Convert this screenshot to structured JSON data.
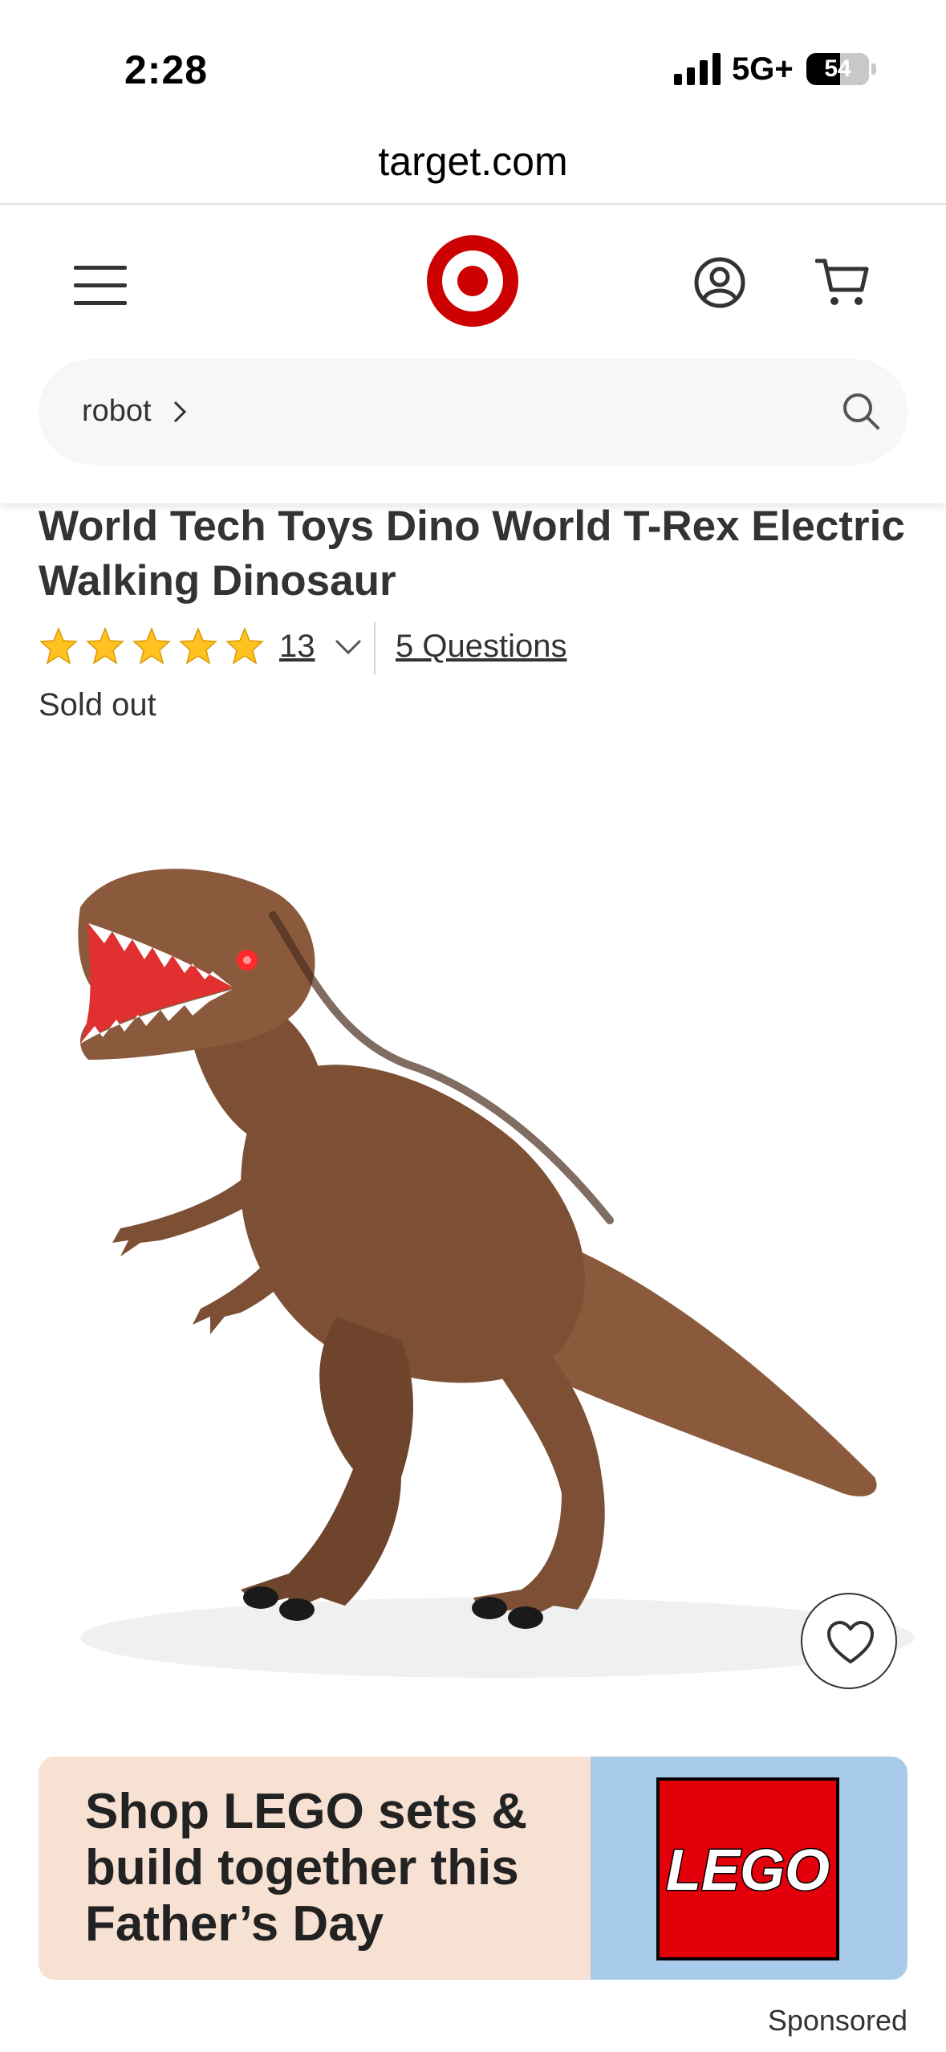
{
  "status_bar": {
    "time": "2:28",
    "network": "5G+",
    "battery": "54"
  },
  "browser": {
    "url": "target.com"
  },
  "header": {
    "menu_icon": "hamburger-icon",
    "logo_icon": "target-bullseye-logo",
    "account_icon": "account-icon",
    "cart_icon": "cart-icon",
    "brand_color": "#cc0000"
  },
  "search": {
    "query": "robot",
    "icon": "search-icon"
  },
  "product": {
    "title": "World Tech Toys Dino World T-Rex Electric Walking Dinosaur",
    "rating": 5,
    "review_count": "13",
    "questions_label": "5 Questions",
    "stock_status": "Sold out",
    "star_color": "#ffc220"
  },
  "ad": {
    "headline": "Shop LEGO sets & build together this Father’s Day",
    "brand_logo": "LEGO",
    "sponsored_label": "Sponsored"
  }
}
